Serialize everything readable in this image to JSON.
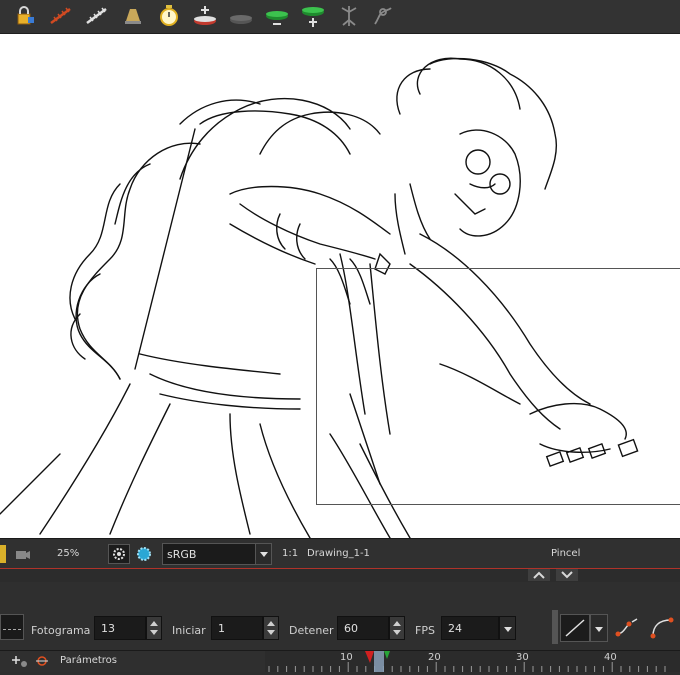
{
  "toolbar": {
    "tools": [
      {
        "name": "lock-icon"
      },
      {
        "name": "onion-skin-red-icon"
      },
      {
        "name": "onion-skin-white-icon"
      },
      {
        "name": "light-table-icon"
      },
      {
        "name": "stopwatch-icon"
      },
      {
        "name": "add-layer-red-icon"
      },
      {
        "name": "remove-layer-icon"
      },
      {
        "name": "subtract-green-icon"
      },
      {
        "name": "add-green-icon"
      },
      {
        "name": "skeleton-icon"
      },
      {
        "name": "deformer-icon"
      }
    ]
  },
  "viewbar": {
    "zoom": "25%",
    "color_space": "sRGB",
    "ratio": "1:1",
    "drawing_name": "Drawing_1-1",
    "tool_name": "Pincel"
  },
  "params": {
    "frame_label": "Fotograma",
    "frame_value": "13",
    "start_label": "Iniciar",
    "start_value": "1",
    "stop_label": "Detener",
    "stop_value": "60",
    "fps_label": "FPS",
    "fps_value": "24"
  },
  "timeline": {
    "params_label": "Parámetros",
    "ticks": [
      "10",
      "20",
      "30",
      "40"
    ],
    "current_frame": 13
  },
  "colors": {
    "panel": "#2f2f2f",
    "accent_red": "#b0332a",
    "green": "#27a437"
  }
}
